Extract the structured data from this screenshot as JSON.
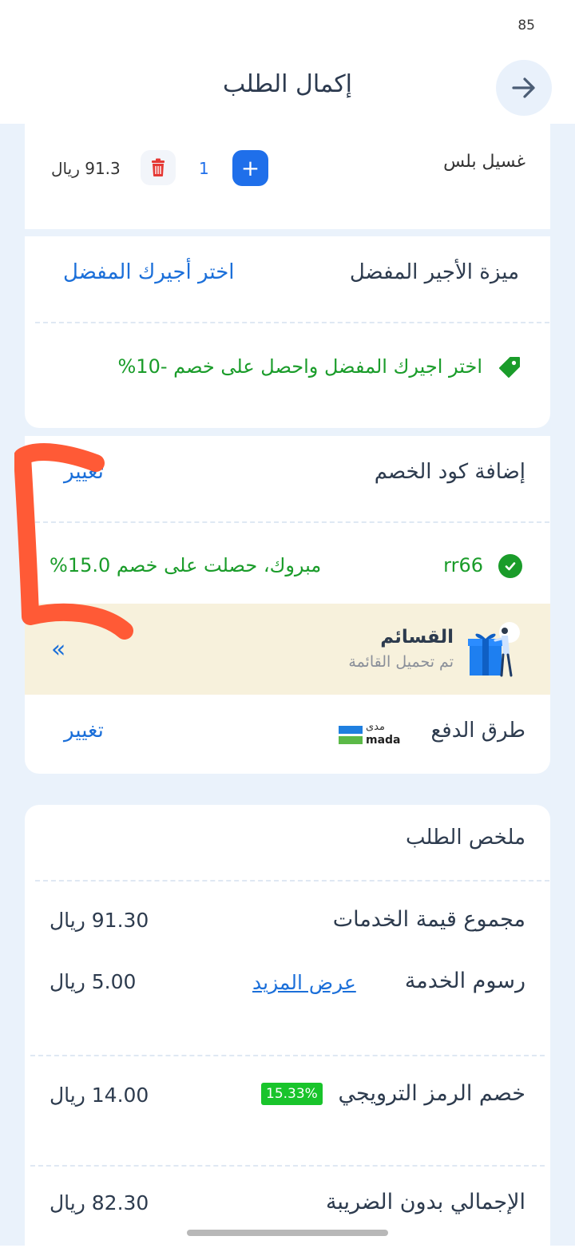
{
  "status": {
    "number": "85"
  },
  "header": {
    "title": "إكمال الطلب",
    "back_icon": "arrow-right-icon"
  },
  "product": {
    "name": "غسيل بلس",
    "quantity": "1",
    "price": "91.3 ريال"
  },
  "preferred_worker": {
    "title": "ميزة الأجير المفضل",
    "choose_link": "اختر أجيرك المفضل",
    "offer": "اختر اجيرك المفضل واحصل على خصم -10%"
  },
  "coupon": {
    "title": "إضافة كود الخصم",
    "change": "تغيير",
    "code": "rr66",
    "message": "مبروك، حصلت على خصم 15.0%"
  },
  "promo": {
    "title": "القسائم",
    "subtitle": "تم تحميل القائمة",
    "chevron": "«"
  },
  "payment": {
    "title": "طرق الدفع",
    "brand_ar": "مدى",
    "brand_en": "mada",
    "change": "تغيير"
  },
  "summary": {
    "title": "ملخص الطلب",
    "rows": [
      {
        "label": "مجموع قيمة الخدمات",
        "value": "91.30 ريال"
      },
      {
        "label": "رسوم الخدمة",
        "value": "5.00 ريال",
        "link": "عرض المزيد"
      },
      {
        "label": "خصم الرمز الترويجي",
        "value": "14.00 ريال",
        "badge": "15.33%"
      },
      {
        "label": "الإجمالي بدون الضريبة",
        "value": "82.30 ريال"
      }
    ]
  },
  "colors": {
    "primary": "#1f6fea",
    "success": "#1a9c2a",
    "background": "#eaf2fb",
    "banner": "#f7f1dc",
    "annotation": "#ff5a36"
  }
}
